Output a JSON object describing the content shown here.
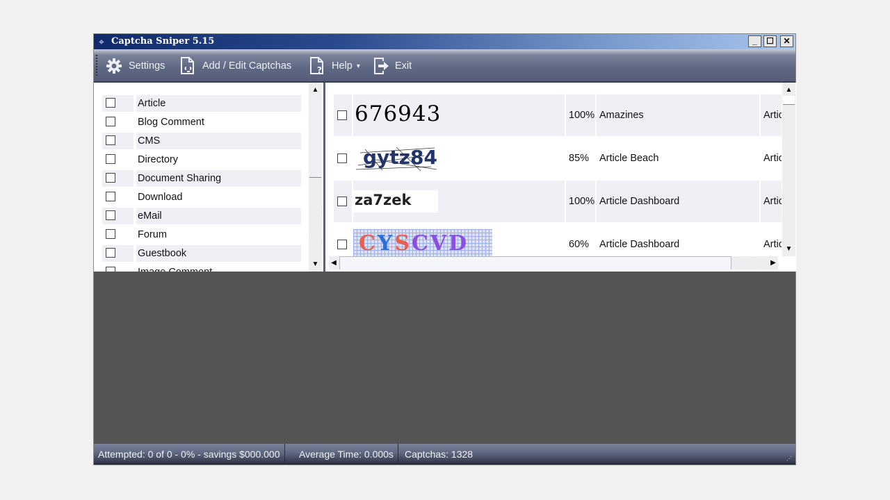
{
  "window": {
    "title": "Captcha Sniper 5.15",
    "app_icon": "crosshair-icon",
    "controls": {
      "minimize": "_",
      "maximize": "☐",
      "close": "✕"
    }
  },
  "toolbar": {
    "items": [
      {
        "label": "Settings",
        "icon": "gear-icon"
      },
      {
        "label": "Add / Edit Captchas",
        "icon": "document-edit-icon"
      },
      {
        "label": "Help",
        "icon": "document-help-icon",
        "dropdown": "▾"
      },
      {
        "label": "Exit",
        "icon": "exit-icon"
      }
    ]
  },
  "categories": {
    "items": [
      {
        "label": "Article",
        "checked": false
      },
      {
        "label": "Blog Comment",
        "checked": false
      },
      {
        "label": "CMS",
        "checked": false
      },
      {
        "label": "Directory",
        "checked": false
      },
      {
        "label": "Document Sharing",
        "checked": false
      },
      {
        "label": "Download",
        "checked": false
      },
      {
        "label": "eMail",
        "checked": false
      },
      {
        "label": "Forum",
        "checked": false
      },
      {
        "label": "Guestbook",
        "checked": false
      },
      {
        "label": "Image Comment",
        "checked": false
      }
    ]
  },
  "captchas": {
    "rows": [
      {
        "image_text": "676943",
        "accuracy": "100%",
        "name": "Amazines",
        "category": "Article",
        "checked": false
      },
      {
        "image_text": "gytz84",
        "accuracy": "85%",
        "name": "Article Beach",
        "category": "Article",
        "checked": false
      },
      {
        "image_text": "za7zek",
        "accuracy": "100%",
        "name": "Article Dashboard",
        "category": "Article",
        "checked": false
      },
      {
        "image_text": "CYSCVD",
        "accuracy": "60%",
        "name": "Article Dashboard",
        "category": "Article",
        "checked": false
      }
    ]
  },
  "scroll": {
    "up": "▲",
    "down": "▼",
    "left": "◀",
    "right": "▶"
  },
  "status": {
    "attempted": "Attempted: 0 of 0 - 0% - savings $000.000",
    "average_time": "Average Time: 0.000s",
    "captchas": "Captchas: 1328"
  }
}
